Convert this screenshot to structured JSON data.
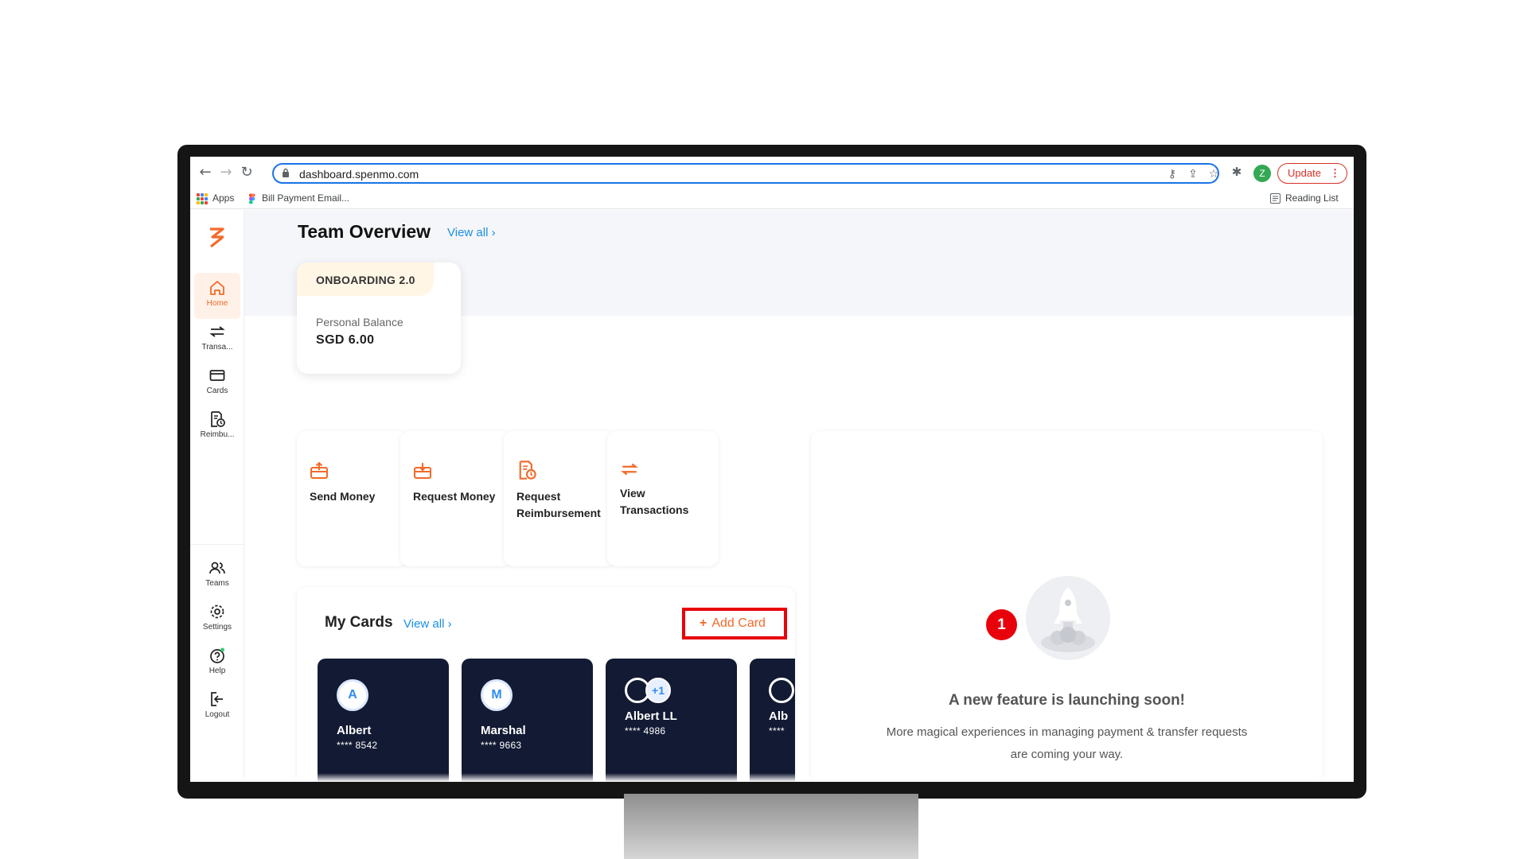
{
  "browser": {
    "url": "dashboard.spenmo.com",
    "profile_initial": "Z",
    "update_label": "Update",
    "bookmarks": {
      "apps": "Apps",
      "bill": "Bill Payment Email...",
      "reading_list": "Reading List"
    }
  },
  "sidebar": {
    "items": [
      {
        "label": "Home",
        "icon": "home-icon"
      },
      {
        "label": "Transa...",
        "icon": "transactions-icon"
      },
      {
        "label": "Cards",
        "icon": "card-icon"
      },
      {
        "label": "Reimbu...",
        "icon": "reimbursement-icon"
      },
      {
        "label": "Teams",
        "icon": "teams-icon"
      },
      {
        "label": "Settings",
        "icon": "gear-icon"
      },
      {
        "label": "Help",
        "icon": "help-icon"
      },
      {
        "label": "Logout",
        "icon": "logout-icon"
      }
    ]
  },
  "team_overview": {
    "title": "Team Overview",
    "view_all": "View all ›",
    "team_name": "ONBOARDING 2.0",
    "balance_label": "Personal Balance",
    "balance": "SGD 6.00"
  },
  "actions": [
    {
      "label": "Send Money",
      "icon": "send-money-icon"
    },
    {
      "label": "Request Money",
      "icon": "request-money-icon"
    },
    {
      "label": "Request Reimbursement",
      "icon": "reimbursement-icon"
    },
    {
      "label": "View Transactions",
      "icon": "transactions-icon"
    }
  ],
  "my_cards": {
    "title": "My Cards",
    "view_all": "View all ›",
    "add_card": "Add Card",
    "cards": [
      {
        "initial": "A",
        "name": "Albert",
        "number": "**** 8542"
      },
      {
        "initial": "M",
        "name": "Marshal",
        "number": "**** 9663"
      },
      {
        "initial": "+1",
        "name": "Albert LL",
        "number": "**** 4986"
      },
      {
        "initial": "",
        "name": "Alb",
        "number": "****"
      }
    ]
  },
  "feature": {
    "title": "A new feature is launching soon!",
    "subtitle": "More magical experiences in managing payment & transfer requests are coming your way."
  },
  "step_marker": "1",
  "colors": {
    "accent": "#f26a2a",
    "link": "#1a8fe6",
    "card_bg": "#131a33",
    "highlight": "#e8000b"
  }
}
